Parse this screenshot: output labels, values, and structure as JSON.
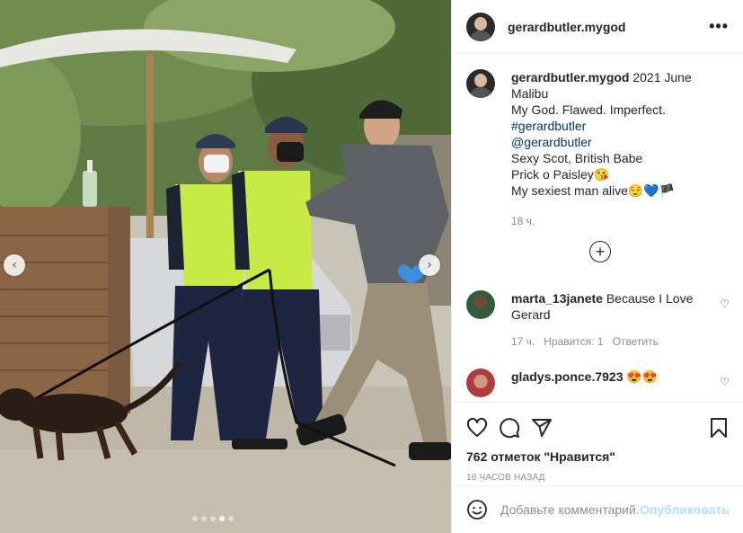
{
  "post": {
    "username": "gerardbutler.mygod",
    "more_icon": "more-options-icon"
  },
  "caption": {
    "username": "gerardbutler.mygod",
    "line1": "2021 June Malibu",
    "line2": "My God. Flawed. Imperfect.",
    "hashtag": "#gerardbutler",
    "mention": "@gerardbutler",
    "line3": "Sexy Scot, British Babe",
    "line4": "Prick o Paisley😘",
    "line5": "My sexiest man alive😌💙🏴",
    "time": "18 ч."
  },
  "comments": [
    {
      "username": "marta_13janete",
      "text": "Because I Love Gerard",
      "time": "17 ч.",
      "likes": "Нравится: 1",
      "reply": "Ответить"
    },
    {
      "username": "gladys.ponce.7923",
      "text": "😍😍"
    }
  ],
  "actions": {
    "likes": "762 отметок \"Нравится\"",
    "ago": "18 ЧАСОВ НАЗАД"
  },
  "add_comment": {
    "placeholder": "Добавьте комментарий...",
    "publish": "Опубликовать"
  },
  "carousel": {
    "slides": 5,
    "active": 3
  },
  "colors": {
    "link": "#00376b",
    "publish_disabled": "#b2dffc",
    "meta": "#8e8e8e"
  }
}
